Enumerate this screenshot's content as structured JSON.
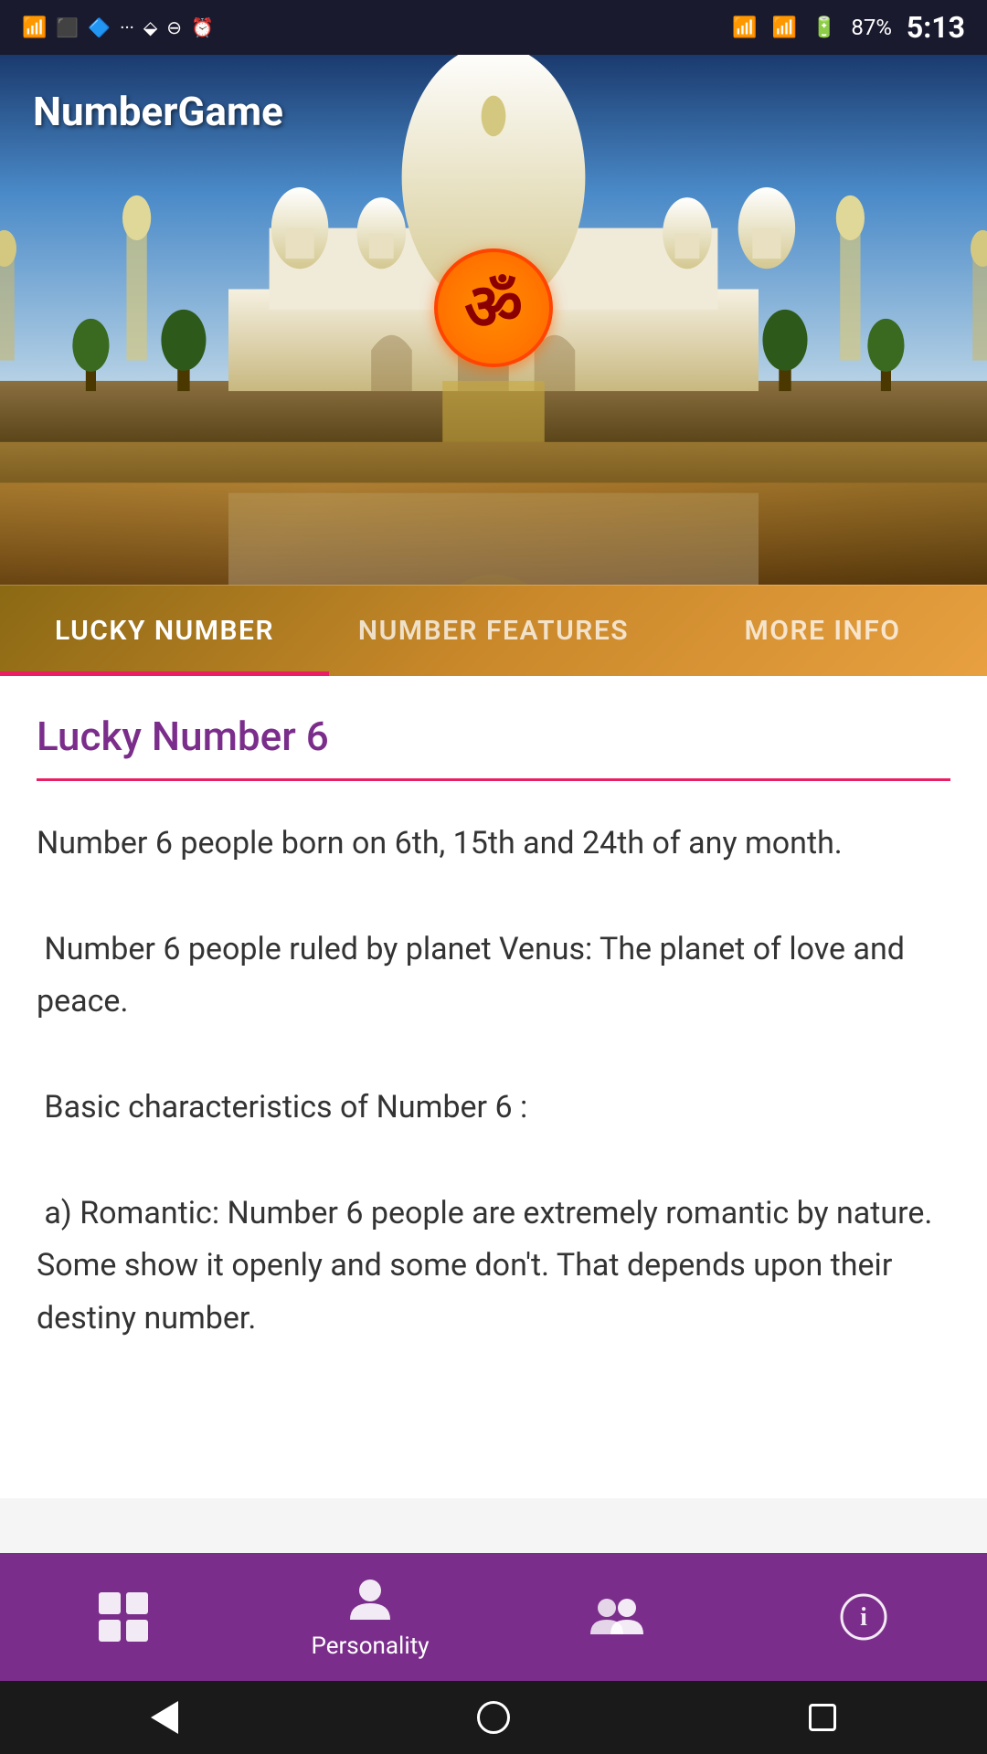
{
  "app": {
    "title": "NumberGame"
  },
  "status_bar": {
    "time": "5:13",
    "battery": "87%",
    "signal": "full"
  },
  "tabs": [
    {
      "id": "lucky-number",
      "label": "LUCKY NUMBER",
      "active": true
    },
    {
      "id": "number-features",
      "label": "NUMBER FEATURES",
      "active": false
    },
    {
      "id": "more-info",
      "label": "MORE INFO",
      "active": false
    }
  ],
  "content": {
    "title": "Lucky Number 6",
    "body": "Number 6 people born on 6th, 15th and 24th of any month.\n\n Number 6 people ruled by planet Venus: The planet of love and peace.\n\n Basic characteristics of Number 6 :\n\n a) Romantic: Number 6 people are extremely romantic by nature. Some show it openly and some don't. That depends upon their destiny number."
  },
  "bottom_nav": {
    "items": [
      {
        "id": "grid",
        "icon": "⊞",
        "label": ""
      },
      {
        "id": "personality",
        "icon": "👤",
        "label": "Personality"
      },
      {
        "id": "group",
        "icon": "👥",
        "label": ""
      },
      {
        "id": "info",
        "icon": "ℹ",
        "label": ""
      }
    ]
  },
  "om_symbol": "ॐ",
  "colors": {
    "accent_purple": "#7B2D8B",
    "accent_pink": "#e91e63",
    "hero_gold": "#C9882A",
    "nav_bg": "#7B2D8B"
  }
}
